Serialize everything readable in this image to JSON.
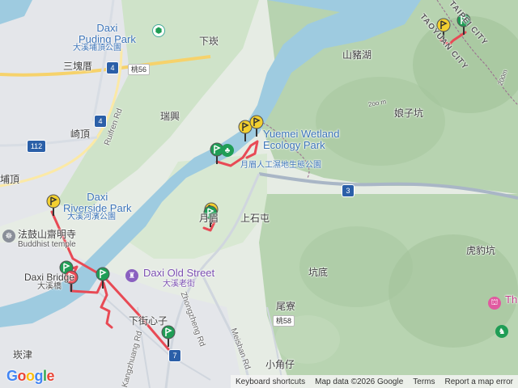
{
  "map": {
    "labels": {
      "daxi_puding_park_en": "Daxi\nPuding Park",
      "daxi_puding_park_zh": "大溪埔頂公園",
      "sankuaicuo": "三塊厝",
      "qiding": "崎頂",
      "xiakan": "下崁",
      "shanzhuhu": "山豬湖",
      "ruixing": "瑞興",
      "niangzikeng": "娘子坑",
      "wetland_en": "Yuemei Wetland\nEcology Park",
      "wetland_zh": "月眉人工濕地生態公園",
      "riverside_en": "Daxi\nRiverside Park",
      "riverside_zh": "大溪河濱公園",
      "fagushan": "法鼓山齋明寺",
      "fagushan_en": "Buddhist temple",
      "daxi_bridge_en": "Daxi Bridge",
      "daxi_bridge_zh": "大溪橋",
      "old_street_en": "Daxi Old Street",
      "old_street_zh": "大溪老街",
      "yuemei": "月眉",
      "shangshitun": "上石屯",
      "kengdi": "坑底",
      "hubaokeng": "虎豹坑",
      "weiliao": "尾寮",
      "xiaojiaozai": "小角仔",
      "xiaxinzi": "下街心子",
      "kanjin": "崁津",
      "puding": "埔頂",
      "ruifren_rd": "Ruifren Rd",
      "zhongzheng_rd": "Zhongzheng Rd",
      "meishan_rd": "Meishan Rd",
      "kangzhuang_rd": "Kangzhuang Rd",
      "taoyuan_city": "TAOYUAN CITY",
      "taipei_city": "TAIPEI CITY",
      "the_partial": "Th",
      "elev_1": "200m",
      "elev_2": "2oo m"
    },
    "road_shields": {
      "r4a": "4",
      "r4b": "4",
      "r112": "112",
      "r3": "3",
      "r7": "7",
      "tao56": "桃56",
      "tao58": "桃58"
    },
    "colors": {
      "river": "#9ecbe0",
      "route": "#e84a55",
      "flag_green": "#1f9d55",
      "flag_yellow": "#f2cf2f",
      "urban": "#e3e4e6",
      "forest": "#b8d7b2",
      "highway": "#f6d26b"
    }
  },
  "footer": {
    "google": "Google",
    "shortcuts": "Keyboard shortcuts",
    "mapdata": "Map data ©2026 Google",
    "terms": "Terms",
    "report": "Report a map error"
  }
}
